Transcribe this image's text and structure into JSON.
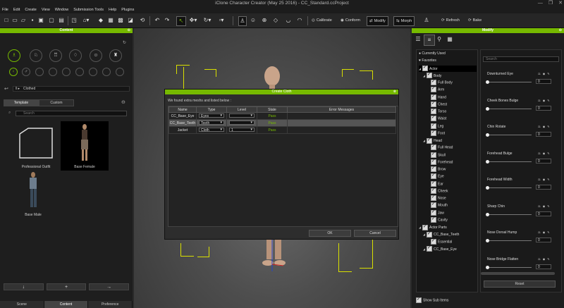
{
  "window": {
    "title": "iClone Character Creator (May 25 2016) - CC_Standard.ccProject",
    "controls": [
      "—",
      "❐",
      "✕"
    ]
  },
  "menu": [
    "File",
    "Edit",
    "Create",
    "View",
    "Window",
    "Submission Tools",
    "Help",
    "Plugins"
  ],
  "toolbar": {
    "calibrate": "Calibrate",
    "conform": "Conform",
    "modify": "Modify",
    "morph": "Morph",
    "refresh": "Refresh",
    "bake": "Bake"
  },
  "content_panel": {
    "title": "Content",
    "nav_path": "Clothed",
    "tabs": [
      "Template",
      "Custom"
    ],
    "active_tab": "Template",
    "search_placeholder": "Search",
    "items": [
      "Professional Outfit",
      "Base Female",
      "Base Male"
    ],
    "selected_item": "Base Female",
    "bottom_buttons": [
      "↓",
      "+",
      "→"
    ],
    "bottom_tabs": [
      "Scene",
      "Content",
      "Preference"
    ],
    "active_bottom_tab": "Content"
  },
  "dialog": {
    "title": "Create Cloth",
    "message": "We found extra meshs and listed below :",
    "columns": [
      "Name",
      "Type",
      "Level",
      "State",
      "Error Messages"
    ],
    "rows": [
      {
        "name": "CC_Base_Eye",
        "type": "Eyes",
        "level": "",
        "state": "Pass",
        "error": ""
      },
      {
        "name": "CC_Base_Teeth",
        "type": "Teeth",
        "level": "",
        "state": "Pass",
        "error": ""
      },
      {
        "name": "Jacket",
        "type": "Cloth",
        "level": "1",
        "state": "Pass",
        "error": ""
      }
    ],
    "ok_label": "OK",
    "cancel_label": "Cancel"
  },
  "modify_panel": {
    "title": "Modify",
    "search_placeholder": "Search",
    "tree": [
      {
        "label": "Currently Used",
        "level": 0,
        "bullet": true
      },
      {
        "label": "Favorites",
        "level": 0,
        "heart": true
      },
      {
        "label": "Actor",
        "level": 0,
        "check": true,
        "selected": true
      },
      {
        "label": "Body",
        "level": 1,
        "check": true
      },
      {
        "label": "Full Body",
        "level": 2,
        "check": true
      },
      {
        "label": "Arm",
        "level": 2,
        "check": true
      },
      {
        "label": "Hand",
        "level": 2,
        "check": true
      },
      {
        "label": "Chest",
        "level": 2,
        "check": true
      },
      {
        "label": "Torso",
        "level": 2,
        "check": true
      },
      {
        "label": "Waist",
        "level": 2,
        "check": true
      },
      {
        "label": "Leg",
        "level": 2,
        "check": true
      },
      {
        "label": "Foot",
        "level": 2,
        "check": true
      },
      {
        "label": "Head",
        "level": 1,
        "check": true
      },
      {
        "label": "Full Head",
        "level": 2,
        "check": true
      },
      {
        "label": "Skull",
        "level": 2,
        "check": true
      },
      {
        "label": "Forehead",
        "level": 2,
        "check": true
      },
      {
        "label": "Brow",
        "level": 2,
        "check": true
      },
      {
        "label": "Eye",
        "level": 2,
        "check": true
      },
      {
        "label": "Ear",
        "level": 2,
        "check": true
      },
      {
        "label": "Cheek",
        "level": 2,
        "check": true
      },
      {
        "label": "Nose",
        "level": 2,
        "check": true
      },
      {
        "label": "Mouth",
        "level": 2,
        "check": true
      },
      {
        "label": "Jaw",
        "level": 2,
        "check": true
      },
      {
        "label": "Cavity",
        "level": 2,
        "check": true
      },
      {
        "label": "Actor Parts",
        "level": 0,
        "check": true
      },
      {
        "label": "CC_Base_Teeth",
        "level": 1,
        "check": true
      },
      {
        "label": "Essential",
        "level": 2,
        "check": true
      },
      {
        "label": "CC_Base_Eye",
        "level": 1,
        "check": true
      }
    ],
    "sliders": [
      {
        "label": "Downturned Eye",
        "value": "0"
      },
      {
        "label": "Cheek Bones Bulge",
        "value": "0"
      },
      {
        "label": "Chin Rotate",
        "value": "0"
      },
      {
        "label": "Forehead Bulge",
        "value": "0"
      },
      {
        "label": "Forehead Width",
        "value": "0"
      },
      {
        "label": "Sharp Chin",
        "value": "0"
      },
      {
        "label": "Nose Dorsal Hump",
        "value": "0"
      },
      {
        "label": "Nose Bridge Flatten",
        "value": "0"
      }
    ],
    "reset_label": "Reset",
    "show_sub_items": "Show Sub Items"
  }
}
